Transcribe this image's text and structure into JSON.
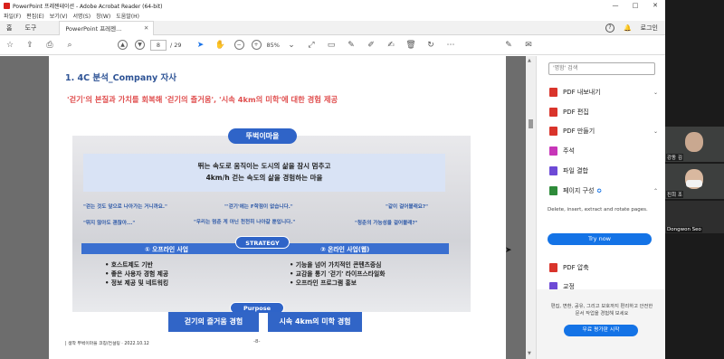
{
  "window": {
    "title": "PowerPoint 프레젠테이션 - Adobe Acrobat Reader (64-bit)",
    "minimize": "—",
    "maximize": "□",
    "close": "✕"
  },
  "menu": [
    "파일(F)",
    "편집(E)",
    "보기(V)",
    "서명(S)",
    "창(W)",
    "도움말(H)"
  ],
  "tabs": {
    "home": "홈",
    "tools": "도구",
    "doc": "PowerPoint 프레젠...",
    "doc_close": "✕",
    "help": "?",
    "bell": "🔔",
    "login": "로그인"
  },
  "toolbar": {
    "page_current": "8",
    "page_total": "/ 29",
    "zoom": "85%"
  },
  "slide": {
    "heading": "1. 4C 분석_Company 자사",
    "subtitle": "'걷기'의 본질과 가치를 회복해 '걷기의 즐거움', '시속 4km의 미학'에 대한 경험 제공",
    "main_pill": "뚜벅이마을",
    "main_text_1": "뛰는 속도로 움직이는 도시의 삶을 잠시 멈추고",
    "main_text_2": "4km/h 걷는 속도의 삶을 경험하는 마을",
    "quotes": [
      "\"걷는 것도 앞으로 나아가는 거니까요.\"",
      "\"'걷기'에는 F학점이 없습니다.\"",
      "\"같이 걸어볼래요?\"",
      "\"뛰지 않아도 괜찮아...\"",
      "\"우리는 멈춘 게 아닌 천천히 나아갈 뿐입니다.\"",
      "\"청춘의 가능성을 걸어볼래?\""
    ],
    "strategy_pill": "STRATEGY",
    "left_bar": "① 오프라인 사업",
    "right_bar": "② 온라인 사업(웹)",
    "left_bullets": [
      "호스트제도 기반",
      "좋은 사용자 경험 제공",
      "정보 제공 및 네트워킹"
    ],
    "right_bullets": [
      "기능을 넘어 가치적인 콘텐츠중심",
      "교감을 통기 '걷기' 라이프스타일화",
      "오프라인 프로그램 홍보"
    ],
    "purpose_pill": "Purpose",
    "purpose_left": "걷기의 즐거움 경험",
    "purpose_right": "시속 4km의 미학 경험",
    "footer_left": "| 생착 뚜벅이마을 코칭/컨설팅 · 2022.10.12",
    "page_num": "-8-"
  },
  "panel": {
    "search_placeholder": "'명함' 검색",
    "tools": [
      {
        "label": "PDF 내보내기",
        "color": "#d9342b",
        "chev": "⌄"
      },
      {
        "label": "PDF 편집",
        "color": "#d9342b",
        "chev": ""
      },
      {
        "label": "PDF 만들기",
        "color": "#d9342b",
        "chev": "⌄"
      },
      {
        "label": "주석",
        "color": "#c736b8",
        "chev": ""
      },
      {
        "label": "파일 결합",
        "color": "#6d4ad6",
        "chev": ""
      },
      {
        "label": "페이지 구성",
        "color": "#2e8b3a",
        "chev": "⌃"
      }
    ],
    "description": "Delete, insert, extract and rotate pages.",
    "try_button": "Try now",
    "tools2": [
      {
        "label": "PDF 압축",
        "color": "#d9342b"
      },
      {
        "label": "교정",
        "color": "#6d4ad6"
      }
    ],
    "promo_text": "편집, 변환, 공유, 그리고 보호까지 편리하고 안전한 문서 작업을 경험해 보세요",
    "promo_button": "무료 평가판 시작"
  },
  "video": [
    {
      "label": "강동 김"
    },
    {
      "label": "진희 조"
    },
    {
      "label": "Dongwon Seo"
    }
  ]
}
